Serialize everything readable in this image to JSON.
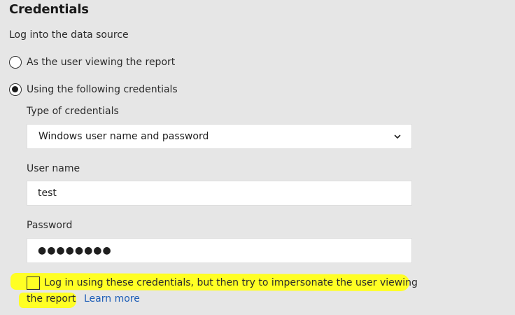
{
  "section": {
    "title": "Credentials",
    "subtitle": "Log into the data source"
  },
  "auth_options": [
    {
      "label": "As the user viewing the report",
      "selected": false
    },
    {
      "label": "Using the following credentials",
      "selected": true
    }
  ],
  "credential_type": {
    "label": "Type of credentials",
    "value": "Windows user name and password"
  },
  "username": {
    "label": "User name",
    "value": "test"
  },
  "password": {
    "label": "Password",
    "masked_value": "●●●●●●●●"
  },
  "impersonate": {
    "checked": false,
    "text_line1": "Log in using these credentials, but then try to impersonate the user viewing",
    "text_line2": "the report",
    "link_label": "Learn more"
  },
  "colors": {
    "background": "#e6e6e6",
    "highlight": "#ffff24",
    "link": "#1f5fb8"
  }
}
